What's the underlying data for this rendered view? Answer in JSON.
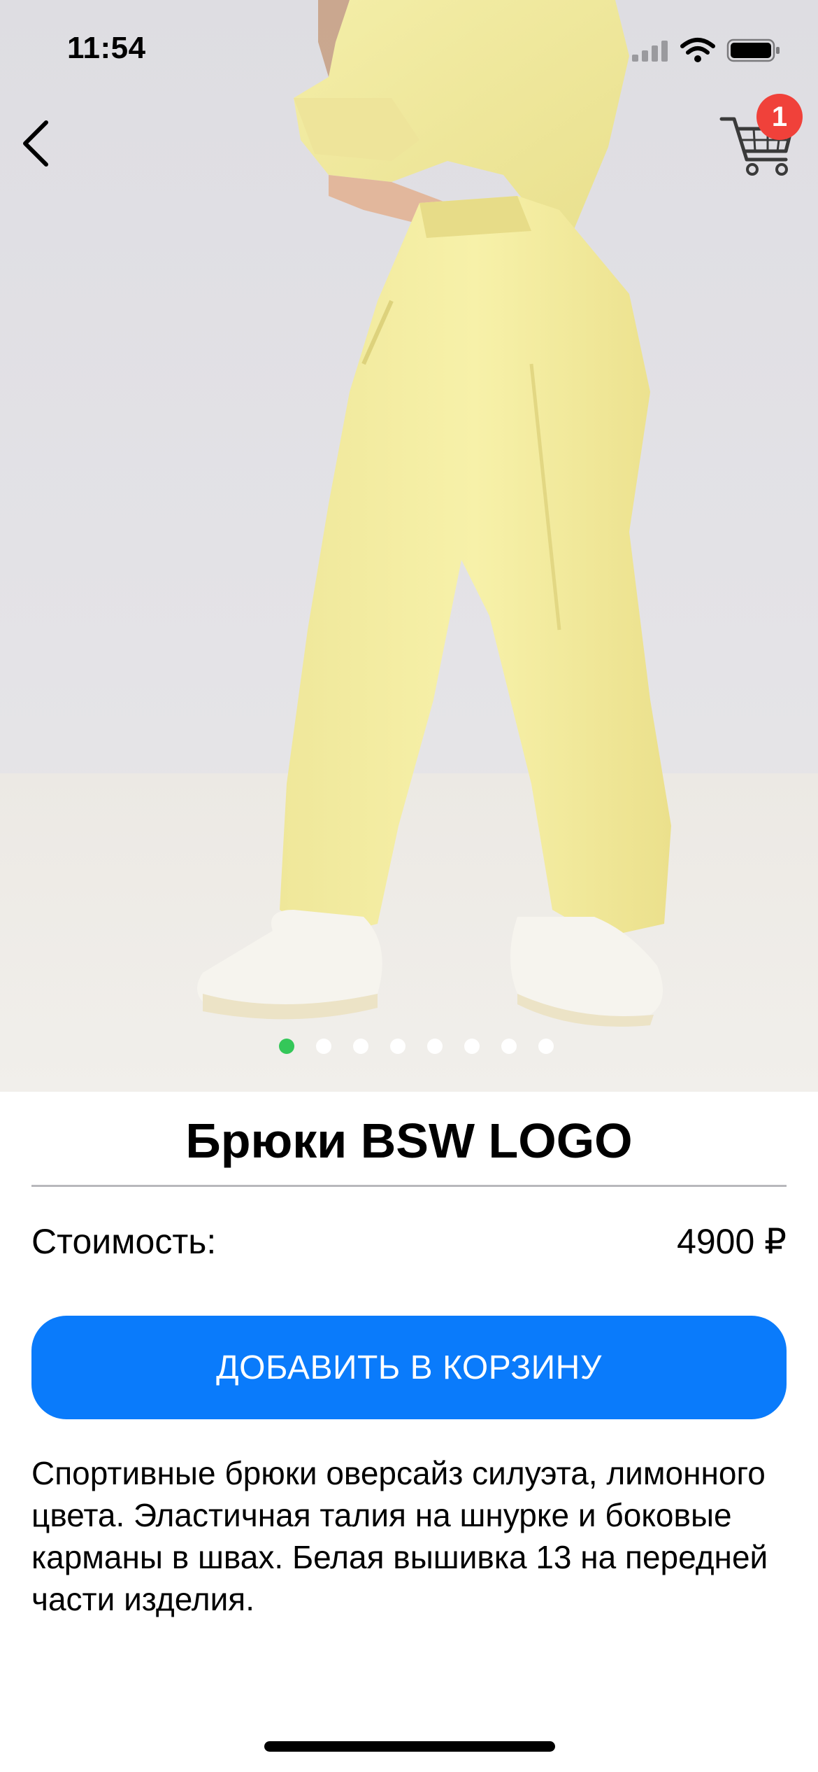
{
  "status_bar": {
    "time": "11:54"
  },
  "nav": {
    "back_icon": "chevron-left-icon",
    "cart_icon": "shopping-cart-icon",
    "cart_badge_count": "1"
  },
  "gallery": {
    "image_description_icon": "product-photo",
    "page_count": 8,
    "active_page": 1
  },
  "product": {
    "title": "Брюки BSW LOGO",
    "price_label": "Стоимость:",
    "price_value": "4900 ₽",
    "add_to_cart_label": "ДОБАВИТЬ В КОРЗИНУ",
    "description": "Спортивные брюки оверсайз силуэта, лимонного цвета. Эластичная талия на шнурке и боковые карманы в швах. Белая вышивка 13 на передней части изделия."
  },
  "colors": {
    "accent_button": "#0a7bfb",
    "badge": "#f0413a",
    "active_dot": "#34c759"
  }
}
